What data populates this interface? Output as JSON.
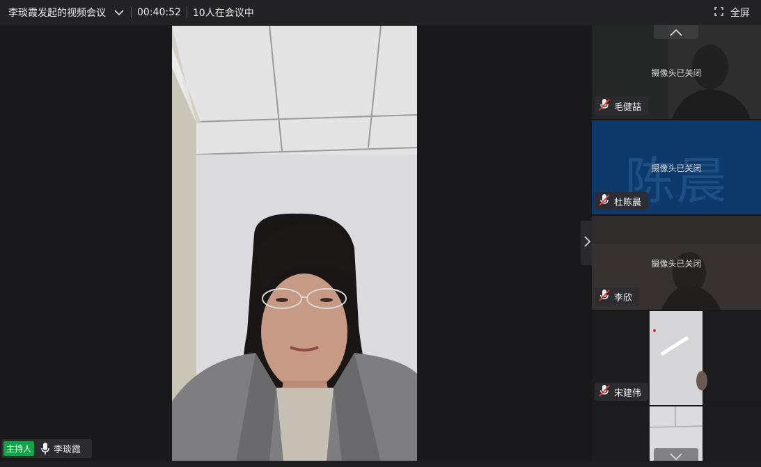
{
  "topbar": {
    "meeting_title": "李琰霞发起的视频会议",
    "elapsed": "00:40:52",
    "participants": "10人在会议中",
    "fullscreen_label": "全屏"
  },
  "main": {
    "host_tag": "主持人",
    "host_name": "李琰霞"
  },
  "tiles": [
    {
      "name": "毛健喆",
      "status": "摄像头已关闭"
    },
    {
      "name": "杜陈晨",
      "status": "摄像头已关闭",
      "avatar_text": "陈晨"
    },
    {
      "name": "李欣",
      "status": "摄像头已关闭"
    },
    {
      "name": "宋建伟"
    }
  ],
  "colors": {
    "host_tag": "#15a34a",
    "avatar_tile_bg": "#0d3a6b",
    "muted_mic": "#e53935"
  }
}
